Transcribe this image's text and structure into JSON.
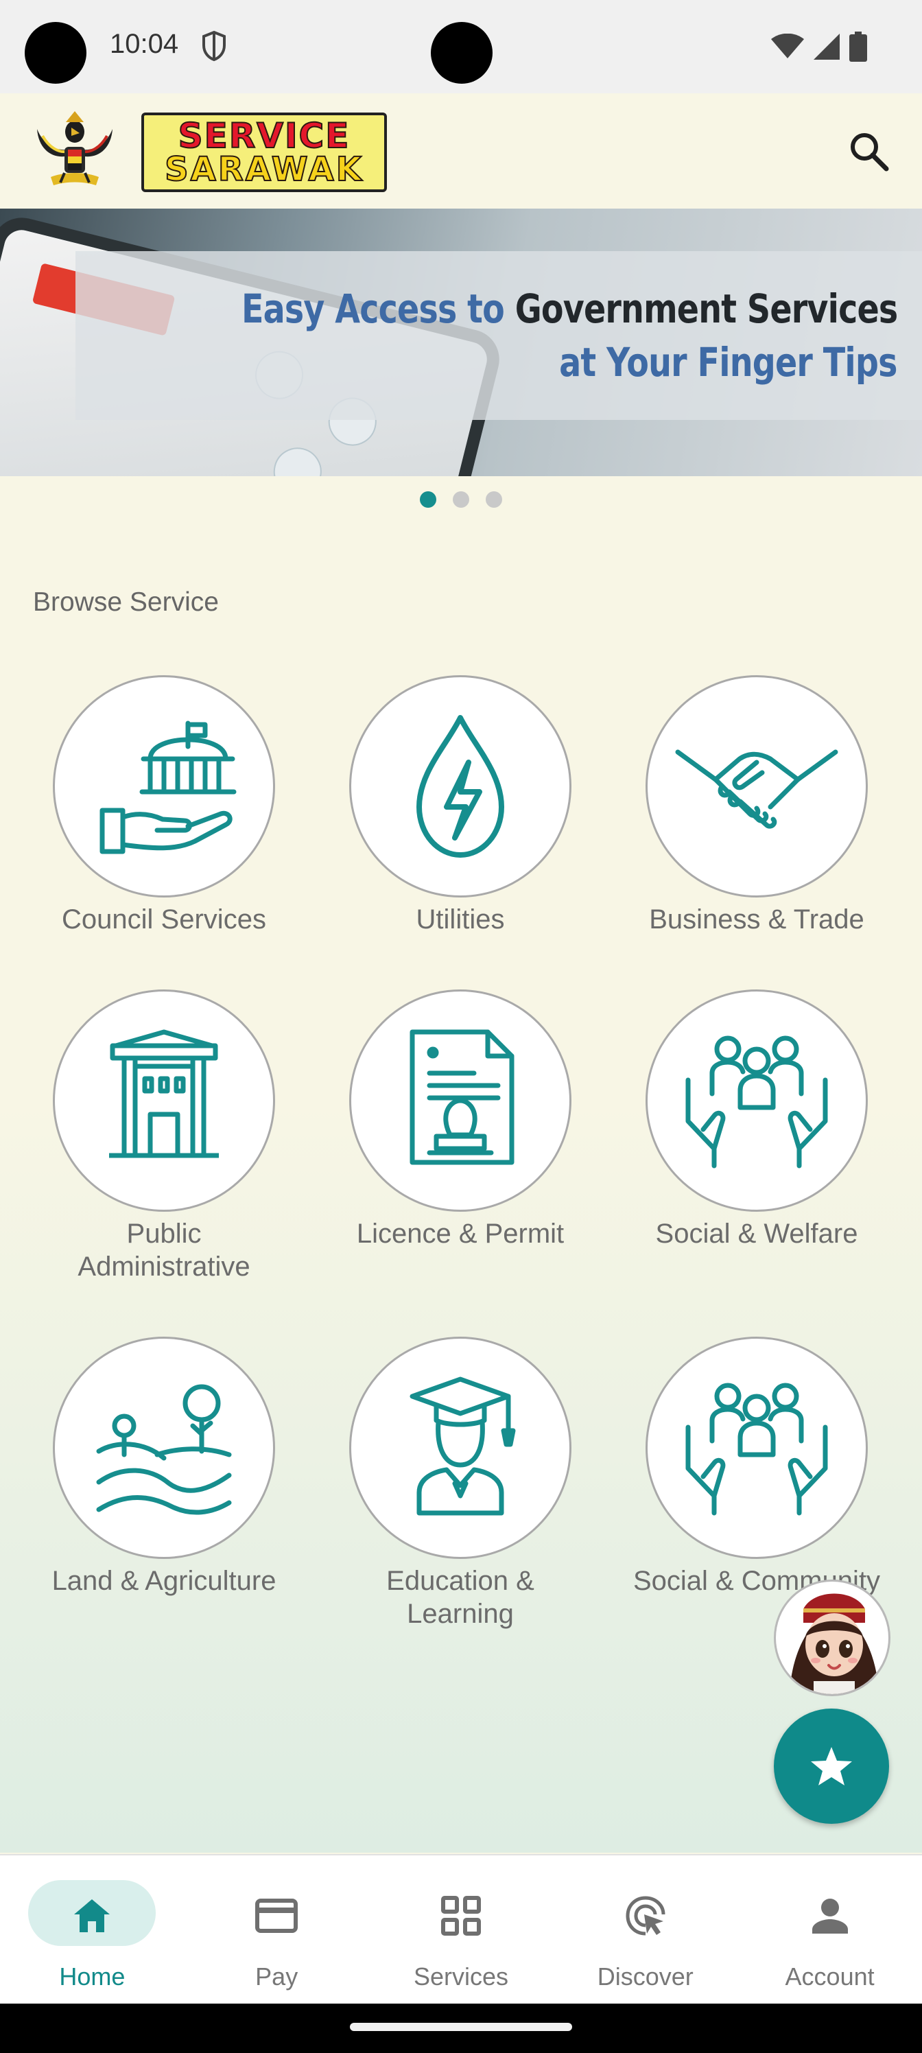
{
  "status_bar": {
    "time": "10:04"
  },
  "header": {
    "logo_top": "SERVICE",
    "logo_bottom": "SARAWAK"
  },
  "banner": {
    "line1_part1": "Easy Access to ",
    "line1_part2": "Government Services",
    "line2": "at Your Finger Tips",
    "slide_count": 3,
    "active_slide": 1
  },
  "section": {
    "title": "Browse Service"
  },
  "services": [
    {
      "label": "Council Services",
      "icon": "hand-building-icon"
    },
    {
      "label": "Utilities",
      "icon": "water-drop-bolt-icon"
    },
    {
      "label": "Business & Trade",
      "icon": "handshake-icon"
    },
    {
      "label": "Public\nAdministrative",
      "icon": "government-building-icon"
    },
    {
      "label": "Licence & Permit",
      "icon": "document-stamp-icon"
    },
    {
      "label": "Social & Welfare",
      "icon": "people-hands-icon"
    },
    {
      "label": "Land & Agriculture",
      "icon": "land-trees-icon"
    },
    {
      "label": "Education &\nLearning",
      "icon": "graduate-icon"
    },
    {
      "label": "Social & Community",
      "icon": "people-hands-icon"
    }
  ],
  "nav": [
    {
      "label": "Home",
      "icon": "home-icon",
      "active": true
    },
    {
      "label": "Pay",
      "icon": "card-icon",
      "active": false
    },
    {
      "label": "Services",
      "icon": "grid-icon",
      "active": false
    },
    {
      "label": "Discover",
      "icon": "discover-icon",
      "active": false
    },
    {
      "label": "Account",
      "icon": "person-icon",
      "active": false
    }
  ],
  "colors": {
    "accent": "#168e8e",
    "background": "#f8f6e5",
    "fab": "#0f8a8a"
  }
}
